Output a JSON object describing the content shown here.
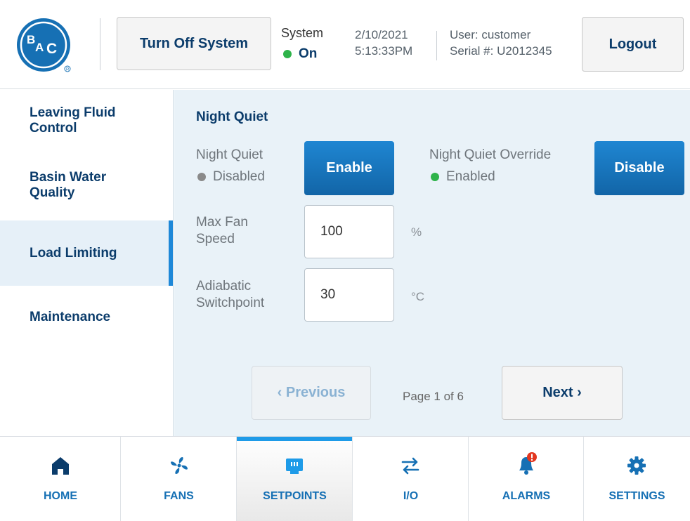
{
  "colors": {
    "accent": "#1670b4",
    "navy": "#0b3c6b",
    "green": "#2eb34a",
    "gray_dot": "#8a8a8a",
    "alert": "#e2361f",
    "active_bar": "#1e88d8"
  },
  "header": {
    "logo_text": "BAC",
    "turn_off_label": "Turn Off System",
    "system_label": "System",
    "system_status": "On",
    "date": "2/10/2021",
    "time": "5:13:33PM",
    "user": "User: customer",
    "serial": "Serial #: U2012345",
    "logout_label": "Logout"
  },
  "sidebar": {
    "items": [
      {
        "label": "Leaving Fluid Control",
        "active": false
      },
      {
        "label": "Basin Water Quality",
        "active": false
      },
      {
        "label": "Load Limiting",
        "active": true
      },
      {
        "label": "Maintenance",
        "active": false
      }
    ]
  },
  "main": {
    "section_title": "Night Quiet",
    "night_quiet": {
      "label": "Night Quiet",
      "status": "Disabled",
      "button": "Enable"
    },
    "override": {
      "label": "Night Quiet Override",
      "status": "Enabled",
      "button": "Disable"
    },
    "max_fan_speed": {
      "label": "Max Fan Speed",
      "value": "100",
      "unit": "%"
    },
    "adiabatic": {
      "label": "Adiabatic Switchpoint",
      "value": "30",
      "unit": "°C"
    },
    "pager": {
      "previous": "‹ Previous",
      "page": "Page 1 of 6",
      "next": "Next ›"
    }
  },
  "bottom_nav": {
    "items": [
      {
        "label": "HOME",
        "icon": "home-icon",
        "active": false
      },
      {
        "label": "FANS",
        "icon": "fan-icon",
        "active": false
      },
      {
        "label": "SETPOINTS",
        "icon": "setpoints-icon",
        "active": true
      },
      {
        "label": "I/O",
        "icon": "io-arrows-icon",
        "active": false
      },
      {
        "label": "ALARMS",
        "icon": "alarm-bell-icon",
        "active": false
      },
      {
        "label": "SETTINGS",
        "icon": "gear-icon",
        "active": false
      }
    ]
  }
}
